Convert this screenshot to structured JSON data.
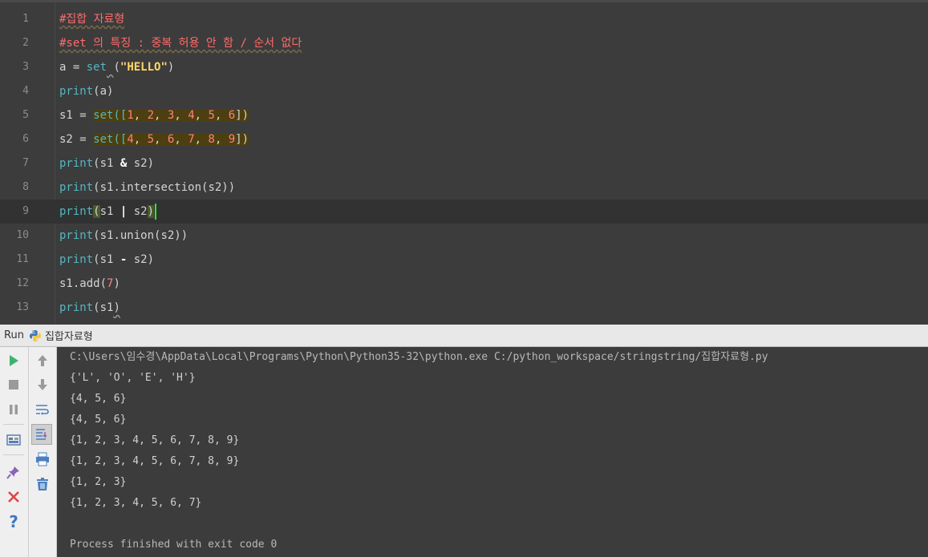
{
  "editor": {
    "lines": [
      {
        "num": "1",
        "parts": [
          {
            "t": "#집합 자료형",
            "c": "c-comment"
          }
        ]
      },
      {
        "num": "2",
        "parts": [
          {
            "t": "#set 의 특징 : 중복 허용 안 함 / 순서 없다",
            "c": "c-comment"
          }
        ]
      },
      {
        "num": "3",
        "parts": [
          {
            "t": "a = "
          },
          {
            "t": "set",
            "c": "c-func"
          },
          {
            "t": " ",
            "c": "wavy"
          },
          {
            "t": "("
          },
          {
            "t": "\"HELLO\"",
            "c": "c-str"
          },
          {
            "t": ")"
          }
        ]
      },
      {
        "num": "4",
        "parts": [
          {
            "t": "print",
            "c": "c-func"
          },
          {
            "t": "(a)"
          }
        ]
      },
      {
        "num": "5",
        "parts": [
          {
            "t": "s1 = "
          },
          {
            "t": "set([",
            "c": "c-func hl"
          },
          {
            "t": "1",
            "c": "c-num hl"
          },
          {
            "t": ", ",
            "c": "hl"
          },
          {
            "t": "2",
            "c": "c-num hl"
          },
          {
            "t": ", ",
            "c": "hl"
          },
          {
            "t": "3",
            "c": "c-num hl"
          },
          {
            "t": ", ",
            "c": "hl"
          },
          {
            "t": "4",
            "c": "c-num hl"
          },
          {
            "t": ", ",
            "c": "hl"
          },
          {
            "t": "5",
            "c": "c-num hl"
          },
          {
            "t": ", ",
            "c": "hl"
          },
          {
            "t": "6",
            "c": "c-num hl"
          },
          {
            "t": "])",
            "c": "hl"
          }
        ]
      },
      {
        "num": "6",
        "parts": [
          {
            "t": "s2 = "
          },
          {
            "t": "set([",
            "c": "c-func hl"
          },
          {
            "t": "4",
            "c": "c-num hl"
          },
          {
            "t": ", ",
            "c": "hl"
          },
          {
            "t": "5",
            "c": "c-num hl"
          },
          {
            "t": ", ",
            "c": "hl"
          },
          {
            "t": "6",
            "c": "c-num hl"
          },
          {
            "t": ", ",
            "c": "hl"
          },
          {
            "t": "7",
            "c": "c-num hl"
          },
          {
            "t": ", ",
            "c": "hl"
          },
          {
            "t": "8",
            "c": "c-num hl"
          },
          {
            "t": ", ",
            "c": "hl"
          },
          {
            "t": "9",
            "c": "c-num hl"
          },
          {
            "t": "])",
            "c": "hl"
          }
        ]
      },
      {
        "num": "7",
        "parts": [
          {
            "t": "print",
            "c": "c-func"
          },
          {
            "t": "(s1 "
          },
          {
            "t": "&",
            "c": "c-op"
          },
          {
            "t": " s2)"
          }
        ]
      },
      {
        "num": "8",
        "parts": [
          {
            "t": "print",
            "c": "c-func"
          },
          {
            "t": "(s1.intersection(s2))"
          }
        ]
      },
      {
        "num": "9",
        "current": true,
        "parts": [
          {
            "t": "print",
            "c": "c-func"
          },
          {
            "t": "(",
            "c": "paren-match"
          },
          {
            "t": "s1 "
          },
          {
            "t": "|",
            "c": "c-op"
          },
          {
            "t": " s2"
          },
          {
            "t": ")",
            "c": "paren-match"
          },
          {
            "caret": true
          }
        ]
      },
      {
        "num": "10",
        "parts": [
          {
            "t": "print",
            "c": "c-func"
          },
          {
            "t": "(s1.union(s2))"
          }
        ]
      },
      {
        "num": "11",
        "parts": [
          {
            "t": "print",
            "c": "c-func"
          },
          {
            "t": "(s1 "
          },
          {
            "t": "-",
            "c": "c-op"
          },
          {
            "t": " s2)"
          }
        ]
      },
      {
        "num": "12",
        "parts": [
          {
            "t": "s1.add("
          },
          {
            "t": "7",
            "c": "c-num"
          },
          {
            "t": ")"
          }
        ]
      },
      {
        "num": "13",
        "parts": [
          {
            "t": "print",
            "c": "c-func"
          },
          {
            "t": "(s1"
          },
          {
            "t": ")",
            "c": "wavy"
          }
        ]
      }
    ]
  },
  "run_panel": {
    "label": "Run",
    "config_name": "집합자료형"
  },
  "console": {
    "lines": [
      "C:\\Users\\임수경\\AppData\\Local\\Programs\\Python\\Python35-32\\python.exe C:/python_workspace/stringstring/집합자료형.py",
      "{'L', 'O', 'E', 'H'}",
      "{4, 5, 6}",
      "{4, 5, 6}",
      "{1, 2, 3, 4, 5, 6, 7, 8, 9}",
      "{1, 2, 3, 4, 5, 6, 7, 8, 9}",
      "{1, 2, 3}",
      "{1, 2, 3, 4, 5, 6, 7}",
      "",
      "Process finished with exit code 0"
    ]
  },
  "colors": {
    "editor_bg": "#3c3c3c",
    "keyword": "#55b6c2",
    "comment": "#ff6b6b",
    "string": "#ffd966",
    "number": "#ff8080",
    "selection": "#4d3f0f",
    "caret": "#2ee82e"
  },
  "icons": {
    "left_toolbar": [
      "run-icon",
      "stop-icon",
      "pause-icon",
      "layout-icon",
      "pin-icon",
      "close-icon",
      "help-icon"
    ],
    "right_toolbar": [
      "up-arrow-icon",
      "down-arrow-icon",
      "soft-wrap-icon",
      "scroll-to-end-icon",
      "print-icon",
      "trash-icon"
    ]
  }
}
